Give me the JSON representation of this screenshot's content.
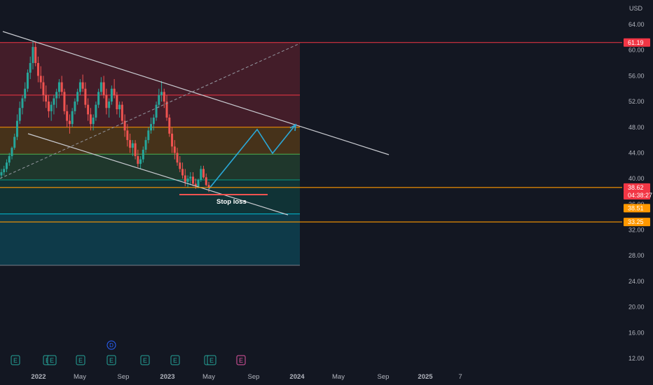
{
  "chart_data": {
    "type": "candlestick",
    "currency": "USD",
    "y_axis_ticks": [
      "64.00",
      "60.00",
      "56.00",
      "52.00",
      "48.00",
      "44.00",
      "40.00",
      "36.00",
      "32.00",
      "28.00",
      "24.00",
      "20.00",
      "16.00",
      "12.00"
    ],
    "y_range": [
      11,
      66
    ],
    "x_axis_ticks": [
      "2022",
      "May",
      "Sep",
      "2023",
      "May",
      "Sep",
      "2024",
      "May",
      "Sep",
      "2025",
      "7"
    ],
    "fib_levels": [
      {
        "price": 61.19,
        "color": "#f23645"
      },
      {
        "price": 53.0,
        "color": "#f23645"
      },
      {
        "price": 48.0,
        "color": "#ff9800"
      },
      {
        "price": 43.8,
        "color": "#4caf50"
      },
      {
        "price": 39.8,
        "color": "#089981"
      },
      {
        "price": 34.5,
        "color": "#00bcd4"
      },
      {
        "price": 26.5,
        "color": "#787b86"
      }
    ],
    "price_tags": [
      {
        "label": "USD",
        "kind": "header"
      },
      {
        "label": "61.19",
        "price": 61.19,
        "color": "#f23645"
      },
      {
        "label": "38.62",
        "price": 38.62,
        "color": "#f23645"
      },
      {
        "label": "04:38:27",
        "price": 37.4,
        "color": "#f23645"
      },
      {
        "label": "38.51",
        "price": 35.4,
        "color": "#ff9800"
      },
      {
        "label": "33.25",
        "price": 33.25,
        "color": "#ff9800"
      }
    ],
    "horizontal_lines": [
      {
        "price": 38.62,
        "color": "#ff9800"
      },
      {
        "price": 33.25,
        "color": "#ff9800"
      }
    ],
    "annotations": [
      {
        "text": "Stop loss",
        "price": 37.1
      }
    ],
    "earnings_markers": [
      "E",
      "E",
      "E",
      "E",
      "E",
      "E",
      "E",
      "E",
      "E",
      "E"
    ],
    "dividend_marker": "D",
    "candles": [
      [
        40.5,
        41.5,
        40,
        41
      ],
      [
        41,
        42,
        40.5,
        41.5
      ],
      [
        41.5,
        43,
        41,
        42.5
      ],
      [
        42.5,
        44,
        42,
        43.5
      ],
      [
        43.5,
        45,
        43,
        44.8
      ],
      [
        44.8,
        47,
        44.5,
        46.5
      ],
      [
        46.5,
        50,
        46,
        49
      ],
      [
        49,
        52,
        48.5,
        51
      ],
      [
        51,
        53,
        50,
        52.5
      ],
      [
        52.5,
        55,
        52,
        54
      ],
      [
        54,
        57,
        53.5,
        56.5
      ],
      [
        56.5,
        59,
        55.5,
        58
      ],
      [
        58,
        61.5,
        57,
        60.5
      ],
      [
        60.5,
        61.2,
        57.5,
        58
      ],
      [
        58,
        59,
        55,
        56
      ],
      [
        56,
        57.5,
        54,
        55
      ],
      [
        55,
        56,
        52,
        53
      ],
      [
        53,
        54.5,
        51,
        52
      ],
      [
        52,
        53,
        49.5,
        50.5
      ],
      [
        50.5,
        52,
        49,
        51.5
      ],
      [
        51.5,
        53,
        50,
        52.5
      ],
      [
        52.5,
        54,
        51,
        53.5
      ],
      [
        53.5,
        55.5,
        52.5,
        55
      ],
      [
        55,
        56,
        53,
        53.5
      ],
      [
        53.5,
        54,
        50,
        50.5
      ],
      [
        50.5,
        51.5,
        48,
        49
      ],
      [
        49,
        50,
        47,
        48.5
      ],
      [
        48.5,
        51,
        48,
        50.5
      ],
      [
        50.5,
        52.5,
        50,
        52
      ],
      [
        52,
        54,
        51.5,
        53.5
      ],
      [
        53.5,
        55.5,
        53,
        55
      ],
      [
        55,
        56.2,
        53.5,
        54
      ],
      [
        54,
        55,
        51,
        51.5
      ],
      [
        51.5,
        52.5,
        49,
        50
      ],
      [
        50,
        51,
        47.5,
        48.5
      ],
      [
        48.5,
        50,
        47.5,
        49.5
      ],
      [
        49.5,
        52,
        49,
        51.5
      ],
      [
        51.5,
        54,
        51,
        53.5
      ],
      [
        53.5,
        55.8,
        53,
        55
      ],
      [
        55,
        56,
        52.5,
        53
      ],
      [
        53,
        54,
        50,
        51
      ],
      [
        51,
        52.5,
        49.5,
        52
      ],
      [
        52,
        54.5,
        51.5,
        54
      ],
      [
        54,
        55.5,
        52.5,
        53
      ],
      [
        53,
        53.5,
        50,
        50.8
      ],
      [
        50.8,
        52,
        49.5,
        51.5
      ],
      [
        51.5,
        52,
        48.5,
        49
      ],
      [
        49,
        50,
        46.5,
        47.5
      ],
      [
        47.5,
        48.5,
        45,
        46
      ],
      [
        46,
        47,
        44,
        44.8
      ],
      [
        44.8,
        46,
        43.5,
        45.5
      ],
      [
        45.5,
        46,
        43,
        43.5
      ],
      [
        43.5,
        44.5,
        41.8,
        42.3
      ],
      [
        42.3,
        43.5,
        41.5,
        43
      ],
      [
        43,
        45,
        42.5,
        44.5
      ],
      [
        44.5,
        46.5,
        44,
        46
      ],
      [
        46,
        48,
        45.5,
        47.5
      ],
      [
        47.5,
        49.5,
        47,
        48.5
      ],
      [
        48.5,
        50,
        47.5,
        49.5
      ],
      [
        49.5,
        52,
        49,
        51.5
      ],
      [
        51.5,
        54,
        51,
        53
      ],
      [
        53,
        55.2,
        52,
        53.5
      ],
      [
        53.5,
        54,
        51,
        52
      ],
      [
        52,
        53,
        49,
        49.5
      ],
      [
        49.5,
        50,
        46.5,
        47
      ],
      [
        47,
        48,
        44,
        45
      ],
      [
        45,
        46,
        43,
        44
      ],
      [
        44,
        44.8,
        42,
        42.5
      ],
      [
        42.5,
        43.5,
        41,
        41.5
      ],
      [
        41.5,
        42.5,
        40,
        40.5
      ],
      [
        40.5,
        41.5,
        38.8,
        39.5
      ],
      [
        39.5,
        40.5,
        38.6,
        40
      ],
      [
        40,
        41,
        39,
        40.3
      ],
      [
        40.3,
        41,
        38.8,
        39.2
      ],
      [
        39.2,
        40,
        38.4,
        38.8
      ],
      [
        38.8,
        40,
        38.5,
        39.8
      ],
      [
        39.8,
        42,
        39.5,
        41.5
      ],
      [
        41.5,
        42,
        40,
        40.2
      ],
      [
        40.2,
        40.8,
        38.8,
        39
      ],
      [
        39,
        39.5,
        37.9,
        38.62
      ]
    ]
  }
}
